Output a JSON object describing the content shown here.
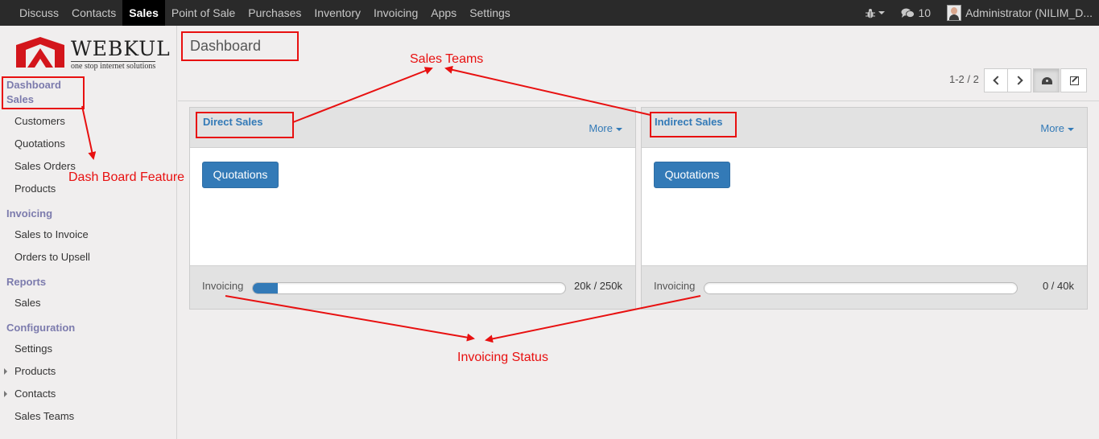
{
  "topbar": {
    "menu": [
      {
        "label": "Discuss",
        "active": false
      },
      {
        "label": "Contacts",
        "active": false
      },
      {
        "label": "Sales",
        "active": true
      },
      {
        "label": "Point of Sale",
        "active": false
      },
      {
        "label": "Purchases",
        "active": false
      },
      {
        "label": "Inventory",
        "active": false
      },
      {
        "label": "Invoicing",
        "active": false
      },
      {
        "label": "Apps",
        "active": false
      },
      {
        "label": "Settings",
        "active": false
      }
    ],
    "debug_icon": "bug-icon",
    "messages_icon": "comments-icon",
    "messages_count": "10",
    "user": "Administrator (NILIM_D..."
  },
  "sidebar": {
    "logo": {
      "text": "WEBKUL",
      "tagline": "one stop internet solutions"
    },
    "sections": [
      {
        "label": "Dashboard",
        "items": []
      },
      {
        "label": "Sales",
        "items": [
          "Customers",
          "Quotations",
          "Sales Orders",
          "Products"
        ]
      },
      {
        "label": "Invoicing",
        "items": [
          "Sales to Invoice",
          "Orders to Upsell"
        ]
      },
      {
        "label": "Reports",
        "items": [
          "Sales"
        ]
      },
      {
        "label": "Configuration",
        "items": [
          "Settings",
          "Products",
          "Contacts",
          "Sales Teams"
        ]
      }
    ]
  },
  "control_panel": {
    "breadcrumb": "Dashboard",
    "pager": "1-2 / 2"
  },
  "teams": [
    {
      "name": "Direct Sales",
      "more": "More",
      "button": "Quotations",
      "invoicing_label": "Invoicing",
      "invoicing_value": "20k / 250k",
      "progress": 0.08
    },
    {
      "name": "Indirect Sales",
      "more": "More",
      "button": "Quotations",
      "invoicing_label": "Invoicing",
      "invoicing_value": "0 / 40k",
      "progress": 0.0
    }
  ],
  "annotations": {
    "sales_teams": "Sales Teams",
    "dashboard_feature": "Dash Board Feature",
    "invoicing_status": "Invoicing Status",
    "color": "#e81010"
  },
  "colors": {
    "topbar": "#2a2a2a",
    "accent": "#337ab7",
    "section": "#7c7bad"
  }
}
